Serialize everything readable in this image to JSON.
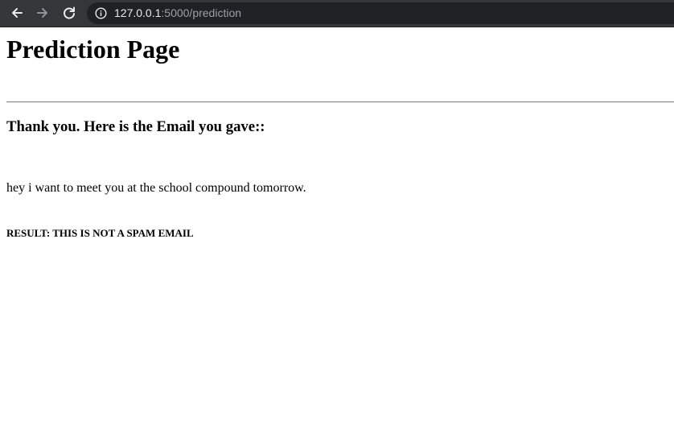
{
  "browser": {
    "url_host": "127.0.0.1",
    "url_path": ":5000/prediction",
    "icons": {
      "back": "arrow-left-icon",
      "forward": "arrow-right-icon",
      "reload": "reload-icon",
      "info": "info-icon"
    },
    "colors": {
      "toolbar_bg": "#35363a",
      "url_bg": "#202124",
      "url_host": "#e8eaed",
      "url_path": "#9aa0a6"
    }
  },
  "page": {
    "title": "Prediction Page",
    "thanks_heading": "Thank you. Here is the Email you gave::",
    "email_text": "hey i want to meet you at the school compound tomorrow.",
    "result_text": "RESULT: THIS IS NOT A SPAM EMAIL"
  }
}
